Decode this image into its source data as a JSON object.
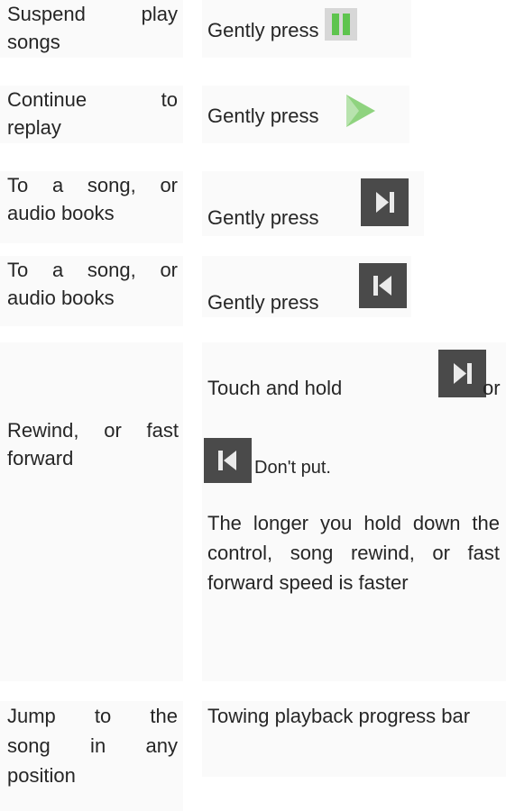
{
  "rows": [
    {
      "action_lines": [
        "Suspend play",
        "songs"
      ],
      "instruction": "Gently press",
      "icon": "pause-icon"
    },
    {
      "action_lines": [
        "Continue to",
        "replay"
      ],
      "instruction": "Gently press",
      "icon": "play-icon"
    },
    {
      "action_lines": [
        "To a song, or",
        "audio books"
      ],
      "instruction": "Gently press",
      "icon": "next-track-icon"
    },
    {
      "action_lines": [
        "To a song, or",
        "audio books"
      ],
      "instruction": "Gently press",
      "icon": "previous-track-icon"
    }
  ],
  "rewind": {
    "action_lines": [
      "Rewind, or fast",
      "forward"
    ],
    "touch_text": "Touch and hold",
    "or_text": "or",
    "dont_put": "Don't put.",
    "explanation": "The longer you hold down the control, song rewind, or fast forward speed is faster",
    "icons": [
      "next-track-icon",
      "previous-track-icon"
    ]
  },
  "jump": {
    "action_lines": [
      "Jump to the",
      "song in any",
      "position"
    ],
    "instruction": "Towing playback progress bar"
  },
  "colors": {
    "text": "#262626",
    "cell_bg": "#fafafa",
    "dark_button": "#4a4a4a",
    "green_icon": "#4ec43a",
    "pause_bars": "#5ec44e",
    "play_arrow": "#8fd37f"
  }
}
